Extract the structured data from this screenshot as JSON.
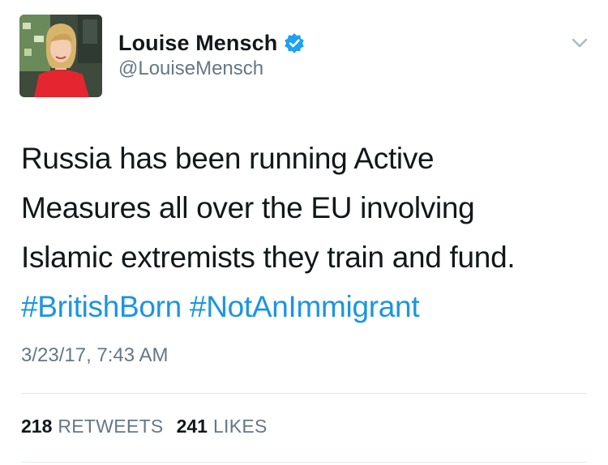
{
  "tweet": {
    "author": {
      "display_name": "Louise Mensch",
      "handle": "@LouiseMensch",
      "verified": true
    },
    "text_lines": [
      "Russia has been running Active",
      "Measures all over the EU involving",
      "Islamic extremists they train and fund."
    ],
    "hashtags": [
      "#BritishBorn",
      "#NotAnImmigrant"
    ],
    "timestamp": "3/23/17, 7:43 AM",
    "stats": {
      "retweets_count": "218",
      "retweets_label": "RETWEETS",
      "likes_count": "241",
      "likes_label": "LIKES"
    }
  },
  "icons": {
    "verified": "verified-badge-icon",
    "menu": "chevron-down-icon"
  },
  "colors": {
    "link": "#1b95e0",
    "secondary_text": "#657786",
    "primary_text": "#14171a",
    "verified_badge": "#1da1f2",
    "divider": "#e1e8ed"
  }
}
